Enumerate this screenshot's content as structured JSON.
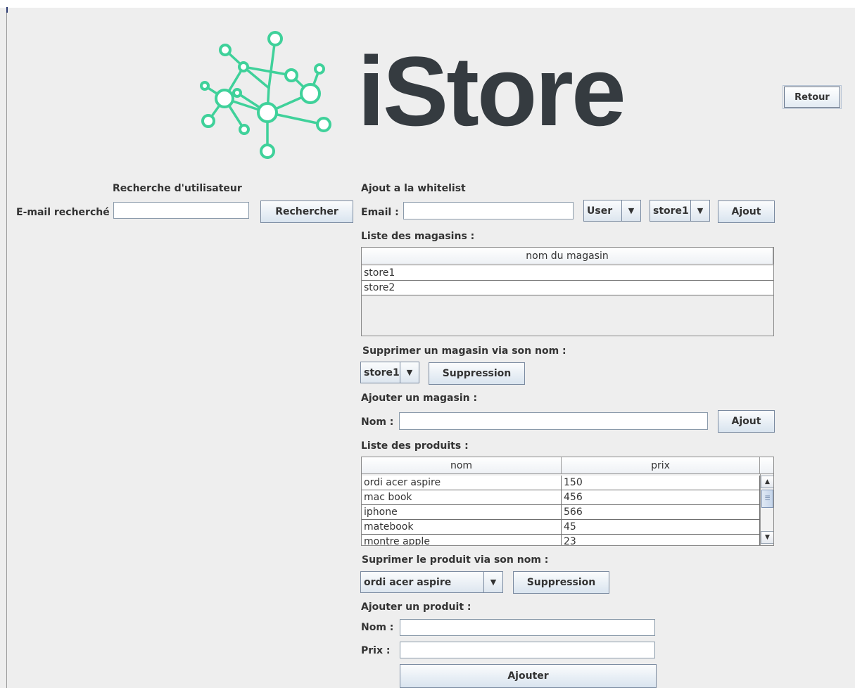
{
  "app": {
    "title": "iStore"
  },
  "colors": {
    "accent": "#3fd19a",
    "text": "#353b40"
  },
  "header": {
    "back_label": "Retour"
  },
  "user_search": {
    "title": "Recherche d'utilisateur",
    "email_label": "E-mail recherché",
    "email_value": "",
    "search_label": "Rechercher"
  },
  "whitelist": {
    "title": "Ajout a la whitelist",
    "email_label": "Email :",
    "email_value": "",
    "role_selected": "User",
    "store_selected": "store1",
    "add_label": "Ajout"
  },
  "stores": {
    "title": "Liste des magasins :",
    "column": "nom du magasin",
    "rows": [
      "store1",
      "store2"
    ]
  },
  "delete_store": {
    "title": "Supprimer un magasin via son nom :",
    "selected": "store1",
    "button_label": "Suppression"
  },
  "add_store": {
    "title": "Ajouter un magasin :",
    "name_label": "Nom :",
    "name_value": "",
    "button_label": "Ajout"
  },
  "products": {
    "title": "Liste des produits :",
    "columns": [
      "nom",
      "prix"
    ],
    "rows": [
      {
        "nom": "ordi acer aspire",
        "prix": "150"
      },
      {
        "nom": "mac book",
        "prix": "456"
      },
      {
        "nom": "iphone",
        "prix": "566"
      },
      {
        "nom": "matebook",
        "prix": "45"
      },
      {
        "nom": "montre apple",
        "prix": "23"
      }
    ]
  },
  "delete_product": {
    "title": "Suprimer le produit via son nom :",
    "selected": "ordi acer aspire",
    "button_label": "Suppression"
  },
  "add_product": {
    "title": "Ajouter un produit :",
    "name_label": "Nom :",
    "name_value": "",
    "price_label": "Prix :",
    "price_value": "",
    "button_label": "Ajouter"
  }
}
